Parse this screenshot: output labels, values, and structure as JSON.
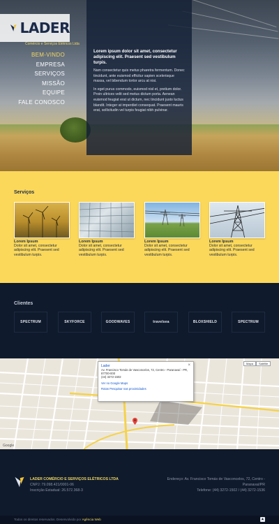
{
  "brand": {
    "name": "LADER",
    "tagline": "Comércio e Serviços Elétricos Ltda"
  },
  "nav": {
    "items": [
      {
        "label": "BEM-VINDO",
        "active": true
      },
      {
        "label": "EMPRESA",
        "active": false
      },
      {
        "label": "SERVIÇOS",
        "active": false
      },
      {
        "label": "MISSÃO",
        "active": false
      },
      {
        "label": "EQUIPE",
        "active": false
      },
      {
        "label": "FALE CONOSCO",
        "active": false
      }
    ]
  },
  "hero": {
    "title": "Lorem ipsum dolor sit amet, consectetur adipiscing elit. Praesent sed vestibulum turpis.",
    "p1": "Nam consectetur quis metus pharetra fermentum. Donec tincidunt, ante euismod efficitur sapien scelerisque massa, vel bibendum tortor arcu at nisi.",
    "p2": "In eget purus commodo, euismod nisl et, pretium dolor. Proin ultrices velit sed metus dictum porta. Aenean euismod feugiat erat ut dictum, nec tincidunt justo luctus blandit. Integer at imperdiet consequat. Praesent mauris erat, sollicitudin vel turpis feugiat nibh pulvinar."
  },
  "services": {
    "heading": "Serviços",
    "items": [
      {
        "title": "Lorem Ipsum",
        "desc": "Dolor sit amet, consectetur adipiscing elit. Praesent sed vestibulum turpis."
      },
      {
        "title": "Lorem Ipsum",
        "desc": "Dolor sit amet, consectetur adipiscing elit. Praesent sed vestibulum turpis."
      },
      {
        "title": "Lorem Ipsum",
        "desc": "Dolor sit amet, consectetur adipiscing elit. Praesent sed vestibulum turpis."
      },
      {
        "title": "Lorem Ipsum",
        "desc": "Dolor sit amet, consectetur adipiscing elit. Praesent sed vestibulum turpis."
      }
    ]
  },
  "clients": {
    "heading": "Clientes",
    "items": [
      "SPECTRUM",
      "SKYFORCE",
      "GOODWAVES",
      "travelsea",
      "BLOXSHIELD",
      "SPECTRUM"
    ]
  },
  "map": {
    "zoom_in": "Mapa",
    "zoom_out": "Satélite",
    "popup_title": "Lader",
    "popup_text": "Av. Francisco Tomás de Vasconcelos, 72, Centro - Paranavaí - PR, 87700-000",
    "popup_phone": "(44) 3272-1502",
    "popup_link_1": "Ver no Google Maps",
    "popup_link_2": "Rotas  Pesquisar nas proximidades",
    "popup_close": "×",
    "attribution": "Google"
  },
  "footer": {
    "company": "LADER COMÉRCIO E SERVIÇOS ELÉTRICOS LTDA",
    "cnpj": "CNPJ: 79.098.421/0001-06",
    "ie": "Inscrição Estadual: 26.572.368-3",
    "address": "Endereço: Av. Francisco Tomás de Vasconcelos, 72, Centro -",
    "city": "Paranavaí/PR",
    "phone": "Telefone: (44) 3272-1502 / (44) 3272-1536"
  },
  "bottom": {
    "text": "Todos os direitos reservados. Desenvolvido por",
    "link": "Agência Web"
  },
  "colors": {
    "accent": "#fbd85a",
    "navy": "#0f1a2c"
  }
}
